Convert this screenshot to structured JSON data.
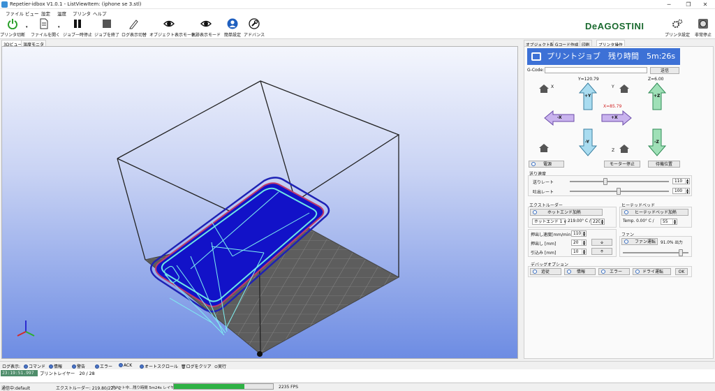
{
  "window": {
    "title": "Repetier-idbox V1.0.1 - ListViewItem: (iphone se 3.stl)",
    "min": "─",
    "max": "❐",
    "close": "✕"
  },
  "menu": [
    "ファイル",
    "ビュー",
    "設定",
    "温度",
    "プリンタ",
    "ヘルプ"
  ],
  "toolbar": {
    "items": [
      "プリンタ切断",
      "ファイルを開く",
      "ジョブ一時停止",
      "ジョブを終了",
      "ログ表示切替",
      "オブジェクト表示モード",
      "軌跡表示モード",
      "簡単設定",
      "アドバンス"
    ],
    "right_items": [
      "プリンタ設定",
      "非常停止"
    ],
    "brand": "DeAGOSTINI",
    "brand_color": "#1a6a2f"
  },
  "left_tabs": [
    "3Dビュー",
    "温度モニタ"
  ],
  "right_tabs": [
    "オブジェクト配置",
    "Gコード作成",
    "印刷",
    "プリンタ操作"
  ],
  "job": {
    "label": "プリントジョブ　残り時間　5m:26s",
    "color": "#3d71d6"
  },
  "gcode": {
    "label": "G-Code:",
    "value": "",
    "send": "送信"
  },
  "axes": {
    "y_readout": "Y=120.79",
    "z_readout": "Z=6.00",
    "x_readout": "X=85.79",
    "x_home": "X",
    "y_home": "Y",
    "z_home": "Z",
    "plus_y": "+Y",
    "minus_y": "-Y",
    "plus_x": "+X",
    "minus_x": "-X",
    "plus_z": "+Z",
    "minus_z": "-Z"
  },
  "power": {
    "label": "電源",
    "motor_stop": "モーター停止",
    "park": "待機位置"
  },
  "speed": {
    "title": "送り速度",
    "feed_label": "送りレート",
    "feed_value": "110",
    "flow_label": "吐出レート",
    "flow_value": "100",
    "feed_level": 0.35,
    "flow_level": 0.3
  },
  "extruder": {
    "title": "エクストルーダー",
    "heat_btn": "ホットエンド加熱",
    "select": "ホットエンド 1",
    "temp": "219.00° C /",
    "target": "220"
  },
  "bed": {
    "title": "ヒーテッドベッド",
    "heat_btn": "ヒーテッドベッド加熱",
    "temp": "Temp.  0.00° C /",
    "target": "55"
  },
  "extrude": {
    "speed_label": "押出し速度[mm/min]",
    "speed_value": "110",
    "ext_label": "押出し [mm]",
    "ext_value": "20",
    "ret_label": "引込み [mm]",
    "ret_value": "10",
    "down": "🡫",
    "up": "🡩"
  },
  "fan": {
    "title": "ファン",
    "btn": "ファン運転",
    "output": "91.0% 出力",
    "level": 0.91
  },
  "debug": {
    "title": "デバッグオプション",
    "items": [
      "追従",
      "情報",
      "エラー",
      "ドライ運転"
    ],
    "ok": "OK"
  },
  "log": {
    "label": "ログ表示:",
    "items": [
      "コマンド",
      "情報",
      "警告",
      "エラー",
      "ACK",
      "オートスクロール"
    ],
    "clear": "ログをクリア",
    "run": "実行",
    "timestamp": "23:19:51.997",
    "line": "プリントレイヤー　20 / 28"
  },
  "status": {
    "connection": "通信中:default",
    "extruder": "エクストルーダー: 219.80/220°C",
    "print": "プリント中...残り時間 5m24s レイヤー 20/28",
    "progress": 0.71,
    "fps": "2235 FPS"
  }
}
